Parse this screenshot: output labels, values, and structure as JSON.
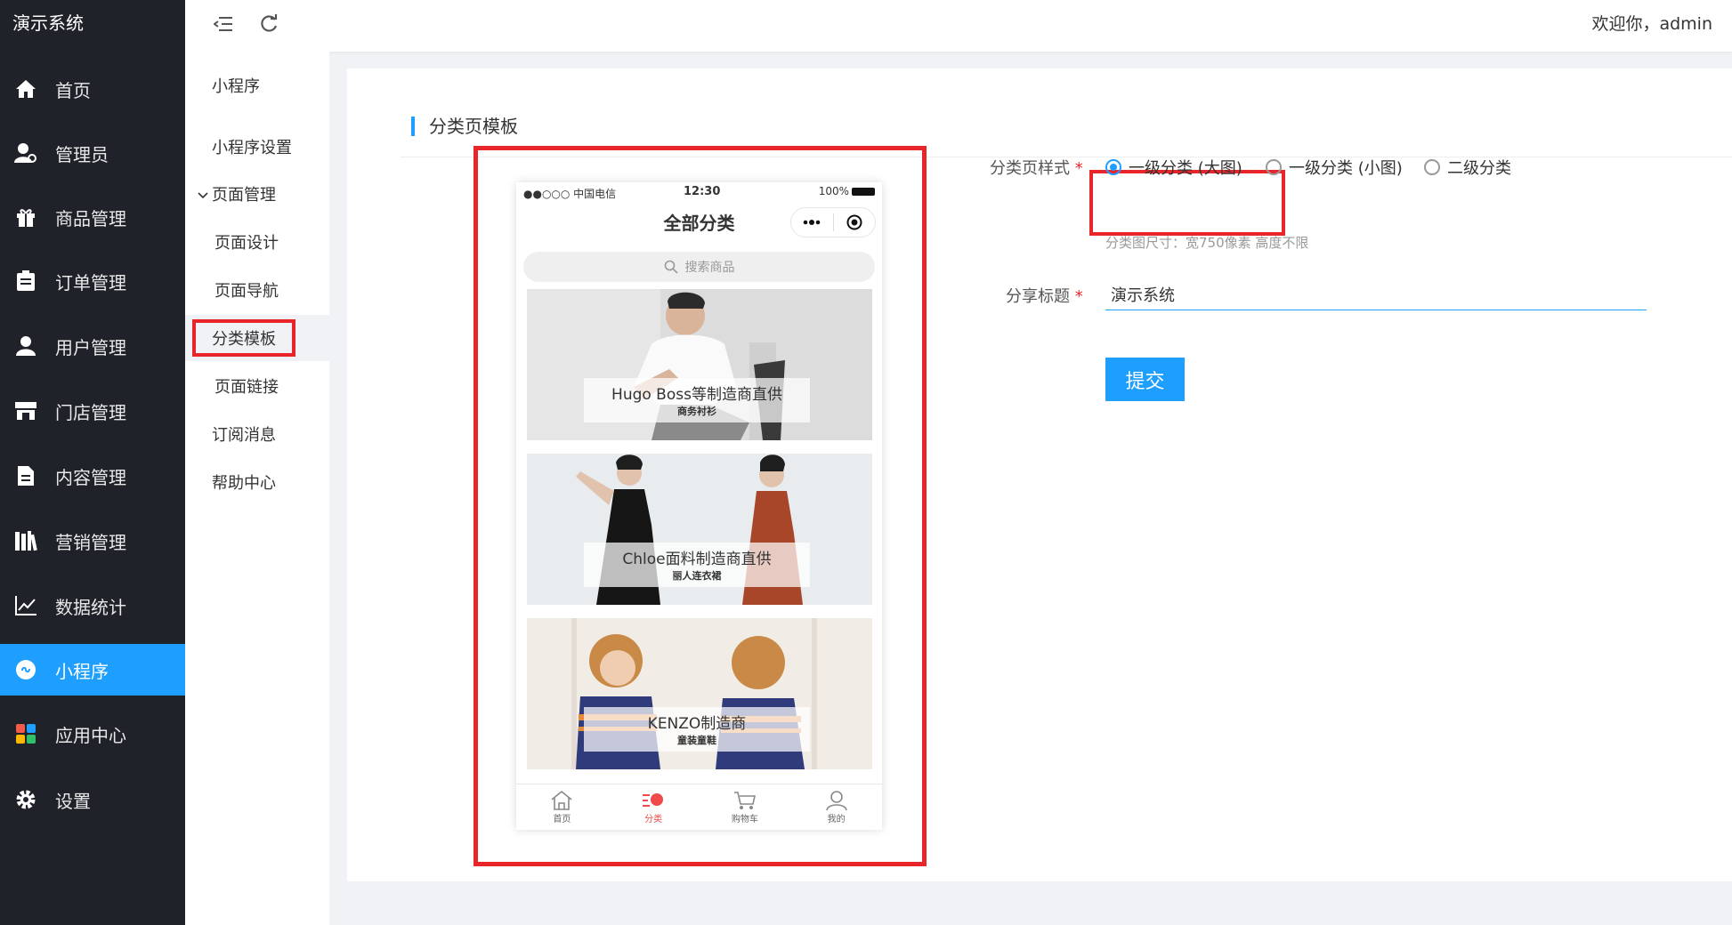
{
  "app": {
    "brand": "演示系统"
  },
  "sidebar": {
    "items": [
      {
        "label": "首页",
        "icon": "home-icon"
      },
      {
        "label": "管理员",
        "icon": "admin-user-icon"
      },
      {
        "label": "商品管理",
        "icon": "gift-icon"
      },
      {
        "label": "订单管理",
        "icon": "clipboard-icon"
      },
      {
        "label": "用户管理",
        "icon": "user-icon"
      },
      {
        "label": "门店管理",
        "icon": "store-icon"
      },
      {
        "label": "内容管理",
        "icon": "document-icon"
      },
      {
        "label": "营销管理",
        "icon": "books-icon"
      },
      {
        "label": "数据统计",
        "icon": "chart-line-icon"
      },
      {
        "label": "小程序",
        "icon": "miniprogram-icon"
      },
      {
        "label": "应用中心",
        "icon": "apps-icon"
      },
      {
        "label": "设置",
        "icon": "gear-icon"
      }
    ],
    "active": "小程序"
  },
  "subnav": {
    "heading": "小程序",
    "items": [
      {
        "label": "小程序设置"
      },
      {
        "label": "页面管理",
        "expanded": true
      },
      {
        "label": "页面设计"
      },
      {
        "label": "页面导航"
      },
      {
        "label": "分类模板",
        "active": true
      },
      {
        "label": "页面链接"
      },
      {
        "label": "订阅消息"
      },
      {
        "label": "帮助中心"
      }
    ]
  },
  "topbar": {
    "welcome": "欢迎你，admin"
  },
  "main": {
    "section_title": "分类页模板",
    "phone": {
      "carrier": "●●○○○ 中国电信",
      "time": "12:30",
      "battery": "100%",
      "title": "全部分类",
      "search_placeholder": "搜索商品",
      "banners": [
        {
          "title": "Hugo Boss等制造商直供",
          "subtitle": "商务衬衫"
        },
        {
          "title": "Chloe面料制造商直供",
          "subtitle": "丽人连衣裙"
        },
        {
          "title": "KENZO制造商",
          "subtitle": "童装童鞋"
        }
      ],
      "tabs": [
        {
          "label": "首页"
        },
        {
          "label": "分类",
          "active": true
        },
        {
          "label": "购物车"
        },
        {
          "label": "我的"
        }
      ]
    },
    "form": {
      "style_label": "分类页样式",
      "options": [
        {
          "label": "一级分类 (大图)",
          "checked": true
        },
        {
          "label": "一级分类 (小图)",
          "checked": false
        },
        {
          "label": "二级分类",
          "checked": false
        }
      ],
      "hint": "分类图尺寸：宽750像素 高度不限",
      "share_label": "分享标题",
      "share_value": "演示系统",
      "submit_label": "提交",
      "required_mark": "*"
    },
    "colors": {
      "accent": "#1e9fff",
      "highlight": "#e8262a",
      "sidebar_bg": "#20222a"
    }
  }
}
